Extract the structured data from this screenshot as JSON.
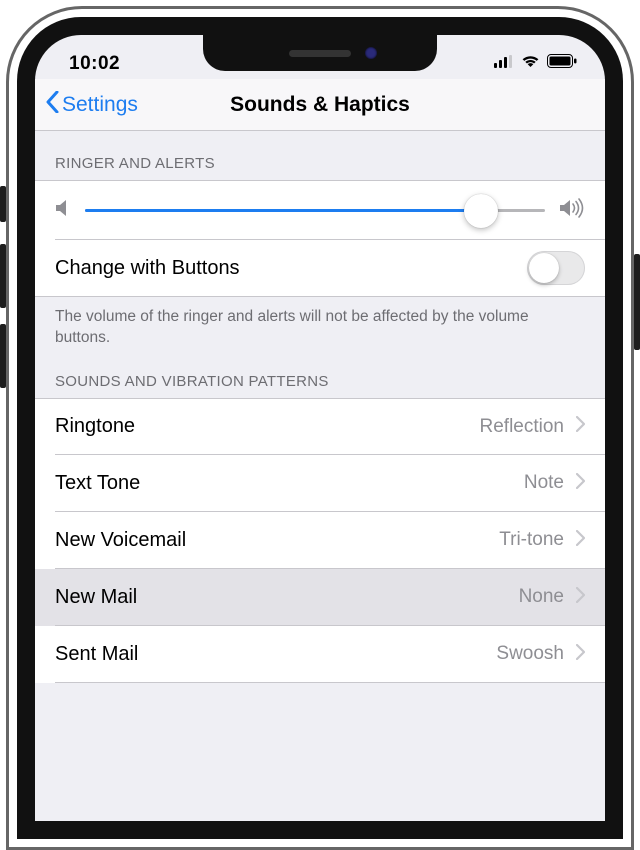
{
  "status": {
    "time": "10:02"
  },
  "nav": {
    "back_label": "Settings",
    "title": "Sounds & Haptics"
  },
  "colors": {
    "tint": "#1d7df0",
    "group_bg": "#efeff4",
    "secondary": "#8e8e93"
  },
  "sections": {
    "ringer": {
      "header": "Ringer and Alerts",
      "slider_value": 0.86,
      "change_with_buttons": {
        "label": "Change with Buttons",
        "on": false
      },
      "footer": "The volume of the ringer and alerts will not be affected by the volume buttons."
    },
    "sounds": {
      "header": "Sounds and Vibration Patterns",
      "rows": [
        {
          "label": "Ringtone",
          "value": "Reflection"
        },
        {
          "label": "Text Tone",
          "value": "Note"
        },
        {
          "label": "New Voicemail",
          "value": "Tri-tone"
        },
        {
          "label": "New Mail",
          "value": "None",
          "highlighted": true
        },
        {
          "label": "Sent Mail",
          "value": "Swoosh"
        }
      ]
    }
  }
}
